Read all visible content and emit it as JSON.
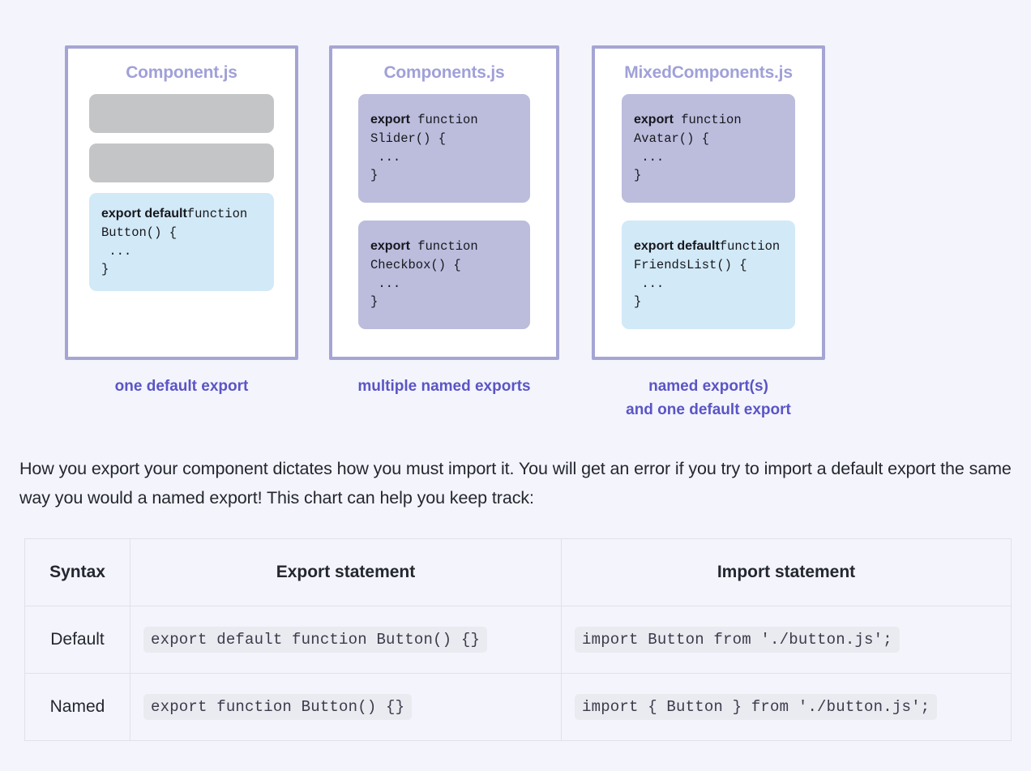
{
  "diagram": {
    "cards": [
      {
        "title": "Component.js",
        "blocks": [
          {
            "kind": "placeholder"
          },
          {
            "kind": "placeholder"
          },
          {
            "kind": "code",
            "variant": "blue",
            "keyword": "export default",
            "rest": "function Button() {\n ...\n}"
          }
        ],
        "caption": "one default export"
      },
      {
        "title": "Components.js",
        "blocks": [
          {
            "kind": "code",
            "variant": "purple",
            "keyword": "export",
            "rest": " function Slider() {\n ...\n}"
          },
          {
            "kind": "code",
            "variant": "purple",
            "keyword": "export",
            "rest": " function Checkbox() {\n ...\n}"
          }
        ],
        "caption": "multiple named exports"
      },
      {
        "title": "MixedComponents.js",
        "blocks": [
          {
            "kind": "code",
            "variant": "purple",
            "keyword": "export",
            "rest": " function Avatar() {\n ...\n}"
          },
          {
            "kind": "code",
            "variant": "blue",
            "keyword": "export default",
            "rest": "function FriendsList() {\n ...\n}"
          }
        ],
        "caption": "named export(s)\nand one default export"
      }
    ]
  },
  "paragraph": "How you export your component dictates how you must import it. You will get an error if you try to import a default export the same way you would a named export! This chart can help you keep track:",
  "table": {
    "headers": [
      "Syntax",
      "Export statement",
      "Import statement"
    ],
    "rows": [
      {
        "syntax": "Default",
        "export_statement": "export default function Button() {}",
        "import_statement": "import Button from './button.js';"
      },
      {
        "syntax": "Named",
        "export_statement": "export function Button() {}",
        "import_statement": "import { Button } from './button.js';"
      }
    ]
  },
  "colors": {
    "page_background": "#f4f4fc",
    "card_border": "#a5a5d4",
    "card_title": "#a0a0d9",
    "caption": "#5a55c6",
    "default_export_block": "#d2e9f7",
    "named_export_block": "#bcbcdd",
    "placeholder_block": "#c3c5c7",
    "table_border": "#e1e1ea",
    "code_chip_background": "#eaeaf1"
  }
}
